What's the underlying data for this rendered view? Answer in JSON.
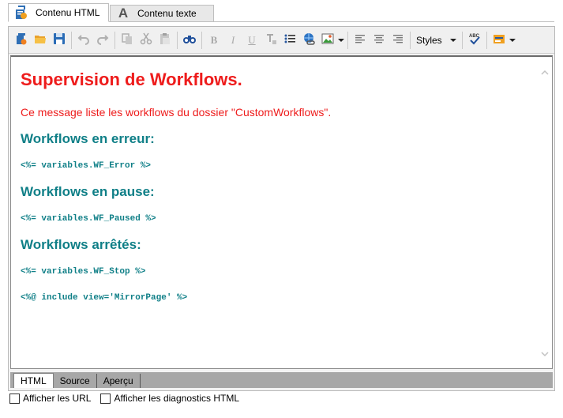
{
  "tabs": [
    {
      "label": "Contenu HTML",
      "icon": "html-document-icon",
      "active": true
    },
    {
      "label": "Contenu texte",
      "icon": "text-a-icon",
      "active": false
    }
  ],
  "toolbar": {
    "styles_label": "Styles",
    "icons": [
      "new-document-icon",
      "open-folder-icon",
      "save-icon",
      "undo-icon",
      "redo-icon",
      "copy-icon",
      "cut-icon",
      "paste-icon",
      "find-binoculars-icon",
      "bold-icon",
      "italic-icon",
      "underline-icon",
      "clear-format-icon",
      "bullet-list-icon",
      "link-icon",
      "image-icon",
      "align-left-icon",
      "align-center-icon",
      "align-right-icon",
      "spellcheck-icon",
      "personalize-icon"
    ]
  },
  "editor": {
    "title": "Supervision de Workflows.",
    "intro": "Ce message liste les workflows du dossier \"CustomWorkflows\".",
    "sections": [
      {
        "heading": "Workflows en erreur:",
        "code": "<%= variables.WF_Error %>"
      },
      {
        "heading": "Workflows en pause:",
        "code": "<%= variables.WF_Paused %>"
      },
      {
        "heading": "Workflows arrêtés:",
        "code": "<%= variables.WF_Stop %>"
      }
    ],
    "include": "<%@ include view='MirrorPage' %>"
  },
  "view_tabs": [
    {
      "label": "HTML",
      "active": true
    },
    {
      "label": "Source",
      "active": false
    },
    {
      "label": "Aperçu",
      "active": false
    }
  ],
  "options": [
    {
      "label": "Afficher les URL",
      "checked": false
    },
    {
      "label": "Afficher les diagnostics HTML",
      "checked": false
    }
  ],
  "colors": {
    "title_red": "#ee1c1c",
    "heading_teal": "#0f7f87"
  }
}
